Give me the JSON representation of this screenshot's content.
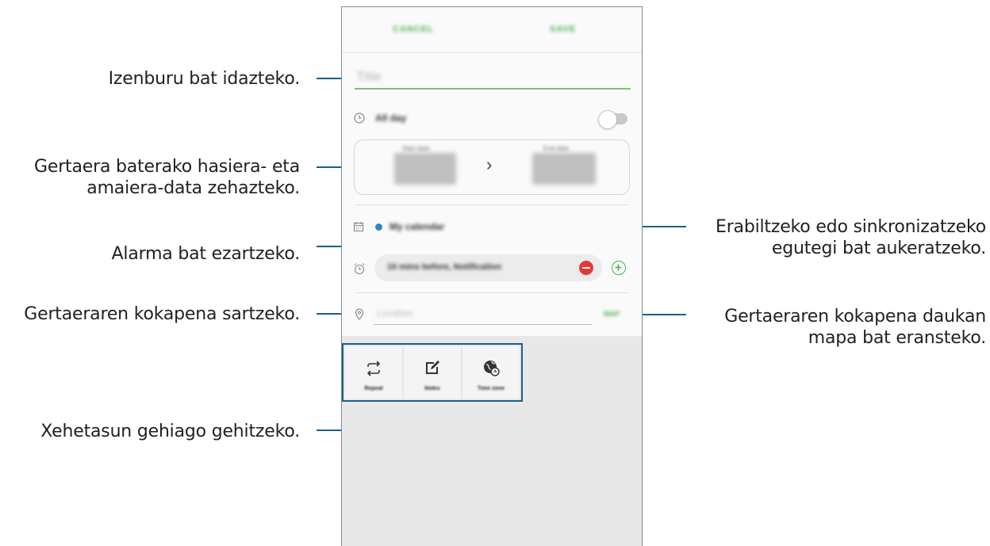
{
  "callouts": {
    "title": "Izenburu bat idazteko.",
    "dates_line1": "Gertaera baterako hasiera- eta",
    "dates_line2": "amaiera-data zehazteko.",
    "alarm": "Alarma bat ezartzeko.",
    "location": "Gertaeraren kokapena sartzeko.",
    "details": "Xehetasun gehiago gehitzeko.",
    "calendar_line1": "Erabiltzeko edo sinkronizatzeko",
    "calendar_line2": "egutegi bat aukeratzeko.",
    "map_line1": "Gertaeraren kokapena daukan",
    "map_line2": "mapa bat eransteko."
  },
  "screen": {
    "cancel_label": "CANCEL",
    "save_label": "SAVE",
    "title_placeholder": "Title",
    "all_day_label": "All day",
    "start_date_label": "Start date",
    "end_date_label": "End date",
    "date_arrow": "›",
    "calendar_name": "My calendar",
    "reminder_text": "10 mins before, Notification",
    "location_placeholder": "Location",
    "map_label": "MAP",
    "tools": [
      {
        "label": "Repeat",
        "icon": "repeat-icon"
      },
      {
        "label": "Notes",
        "icon": "notes-icon"
      },
      {
        "label": "Time zone",
        "icon": "time-zone-icon"
      }
    ]
  },
  "colors": {
    "accent_green": "#4caf50",
    "leader_blue": "#1e5f86",
    "calendar_dot": "#2e86c1",
    "remove_red": "#e53935"
  }
}
